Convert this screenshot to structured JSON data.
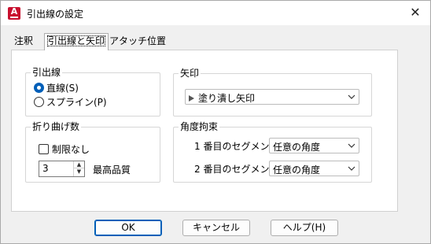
{
  "window": {
    "title": "引出線の設定",
    "app_icon_letter": "A"
  },
  "tabs": [
    {
      "label": "注釈"
    },
    {
      "label": "引出線と矢印"
    },
    {
      "label": "アタッチ位置"
    }
  ],
  "leader_line": {
    "legend": "引出線",
    "options": [
      {
        "label": "直線(S)",
        "selected": true
      },
      {
        "label": "スプライン(P)",
        "selected": false
      }
    ]
  },
  "arrow": {
    "legend": "矢印",
    "value": "塗り潰し矢印"
  },
  "vertex_count": {
    "legend": "折り曲げ数",
    "no_limit_label": "制限なし",
    "no_limit_checked": false,
    "value": "3",
    "max_label": "最高品質"
  },
  "angle_constraint": {
    "legend": "角度拘束",
    "first_segment_label": "1 番目のセグメント:",
    "first_segment_value": "任意の角度",
    "second_segment_label": "2 番目のセグメント:",
    "second_segment_value": "任意の角度"
  },
  "buttons": {
    "ok": "OK",
    "cancel": "キャンセル",
    "help": "ヘルプ(H)"
  }
}
